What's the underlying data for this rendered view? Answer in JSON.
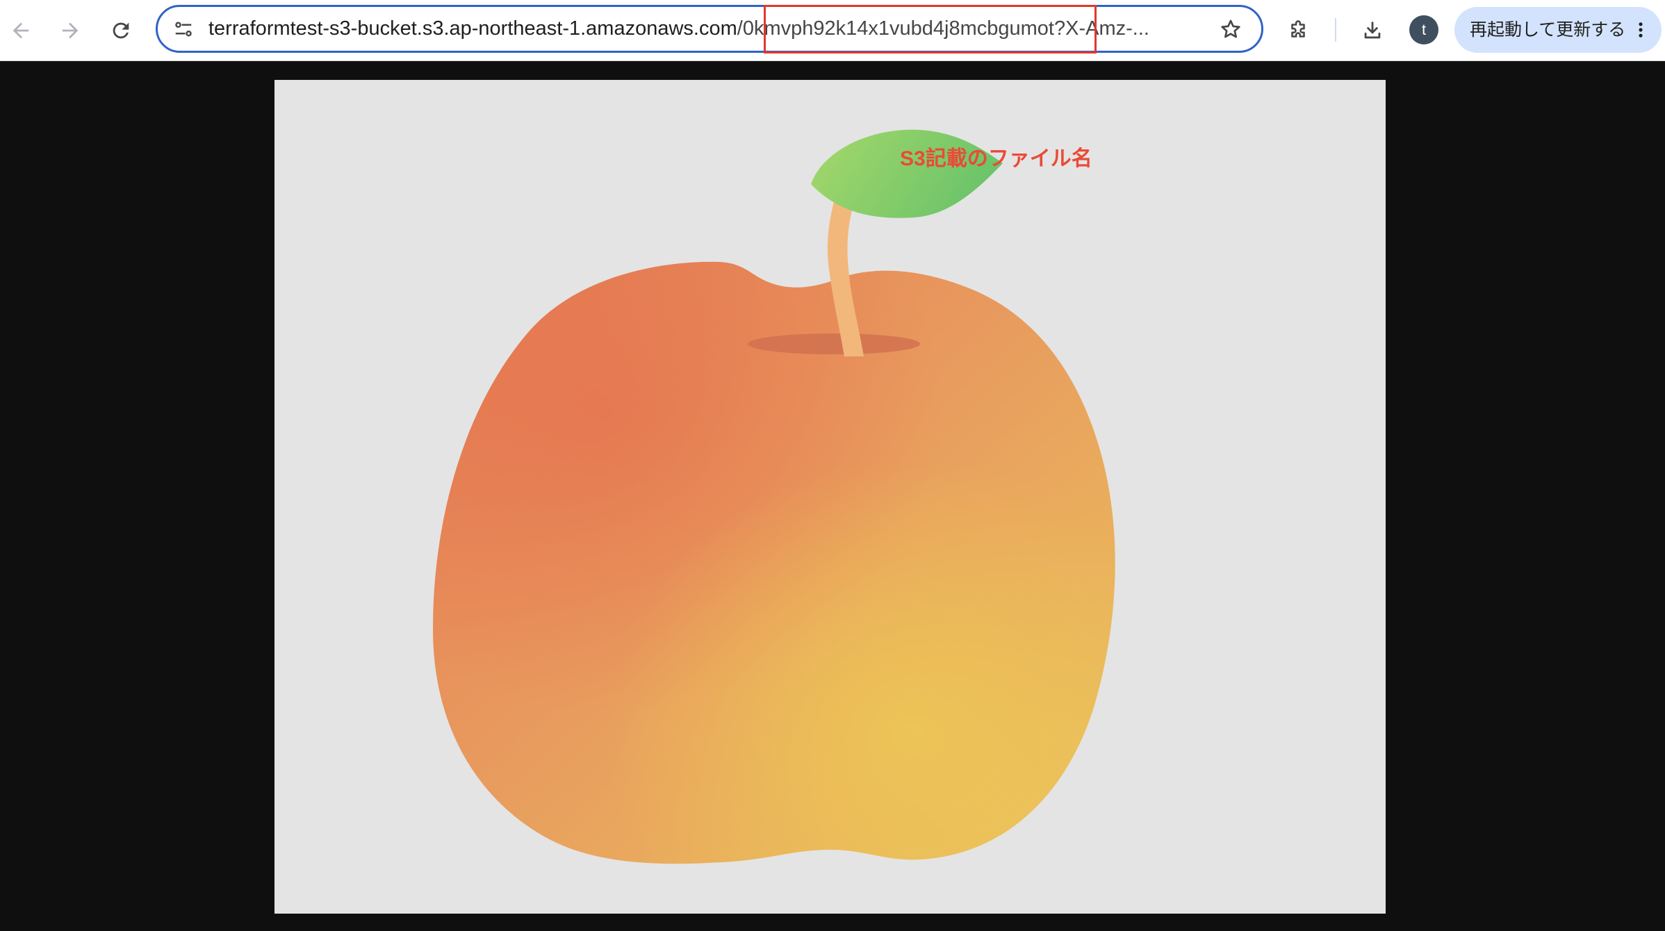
{
  "browser": {
    "url_host": "terraformtest-s3-bucket.s3.ap-northeast-1.amazonaws.com",
    "url_path": "/0kmvph92k14x1vubd4j8mcbgumot?X-Amz-...",
    "avatar_letter": "t",
    "update_button_label": "再起動して更新する",
    "icons": {
      "back": "arrow-left-icon",
      "forward": "arrow-right-icon",
      "reload": "reload-icon",
      "site_info": "tune-icon",
      "bookmark": "star-icon",
      "extensions": "puzzle-icon",
      "downloads": "download-icon",
      "menu": "kebab-menu-icon"
    }
  },
  "page": {
    "annotation_label": "S3記載のファイル名",
    "image_subject": "apple-illustration"
  },
  "colors": {
    "omnibox_border": "#2f63c6",
    "annotation_red": "#ea4a37",
    "update_button_bg": "#d3e3fd",
    "page_background": "#0f0f0f",
    "image_background": "#e4e4e4"
  }
}
